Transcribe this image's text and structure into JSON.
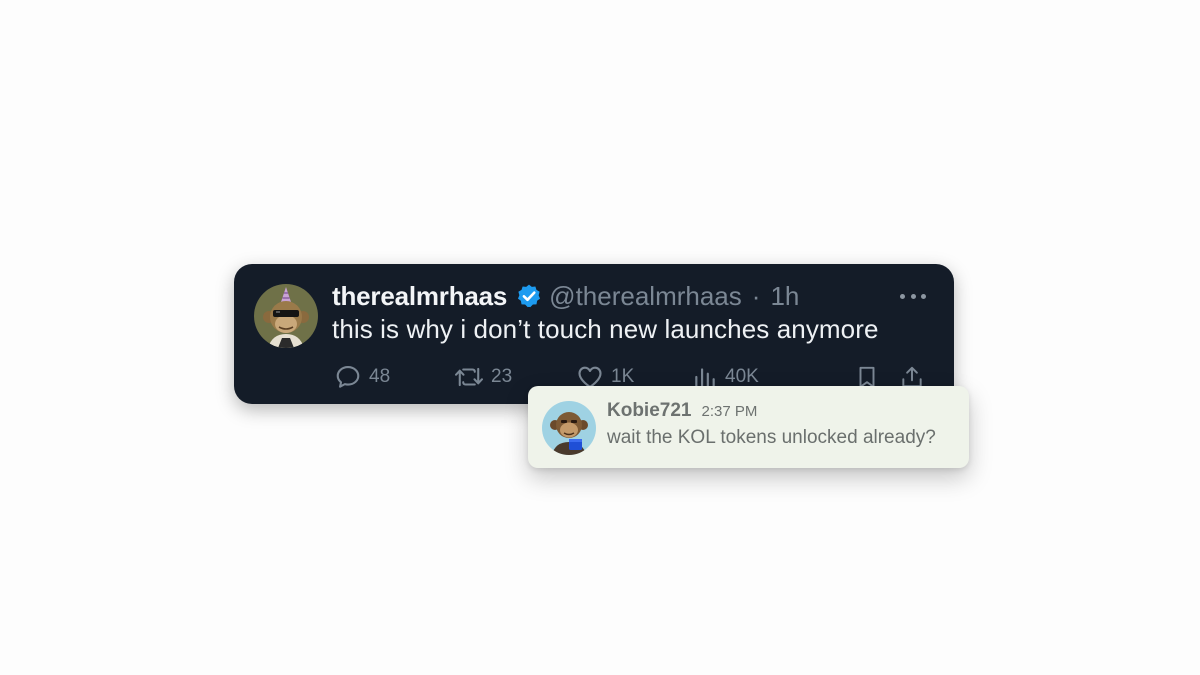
{
  "tweet": {
    "display_name": "therealmrhaas",
    "handle": "@therealmrhaas",
    "separator": "·",
    "timestamp": "1h",
    "text": "this is why i don’t touch new launches anymore",
    "avatar_icon": "bored-ape-party-hat-avatar",
    "verified_icon": "verified-badge-icon",
    "actions": {
      "replies": "48",
      "retweets": "23",
      "likes": "1K",
      "views": "40K"
    },
    "colors": {
      "card_background": "#141c28",
      "verified_blue": "#1d9bf0",
      "muted_text": "#7b8794"
    }
  },
  "chat": {
    "username": "Kobie721",
    "time": "2:37 PM",
    "message": "wait the KOL tokens unlocked already?",
    "avatar_icon": "bored-ape-blue-avatar",
    "colors": {
      "bubble_background": "#eff3ea",
      "text": "#6a6f6d"
    }
  }
}
